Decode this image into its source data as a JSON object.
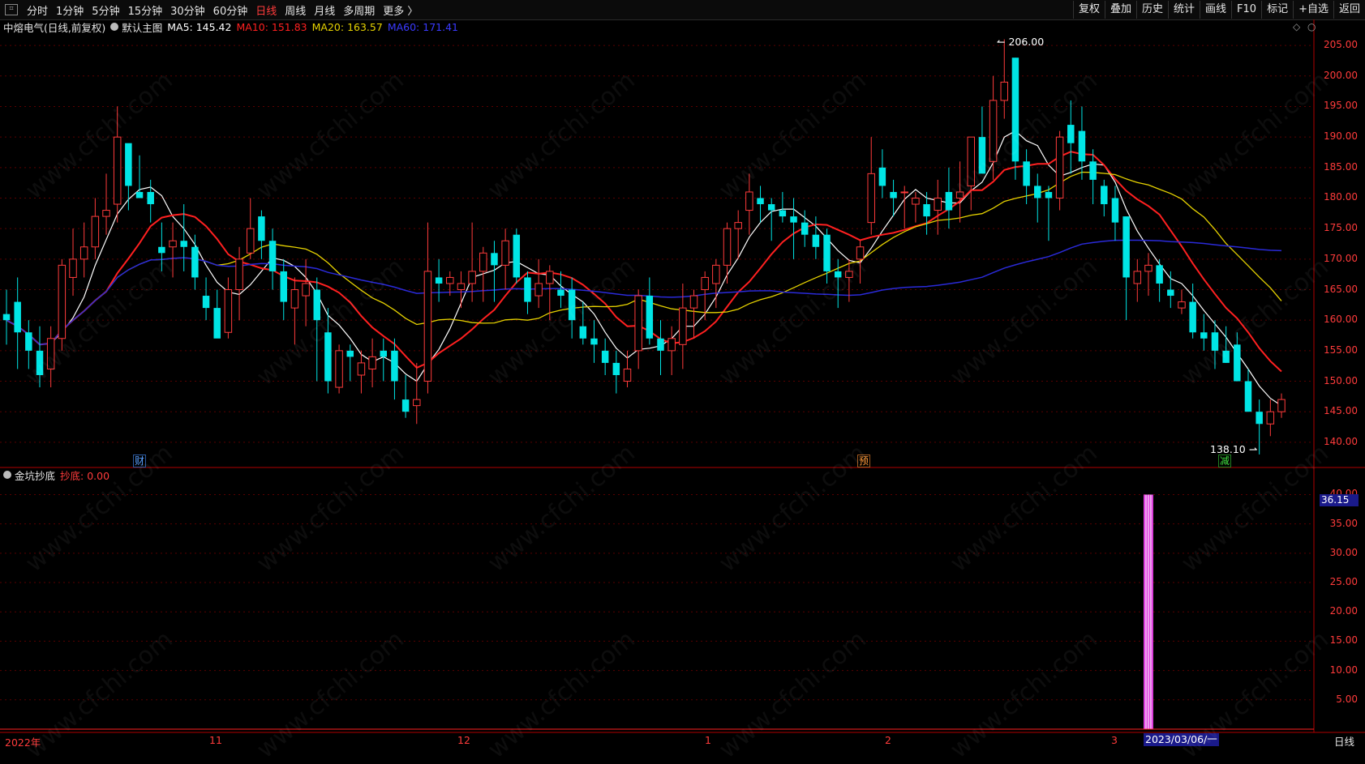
{
  "toolbar": {
    "periods": [
      "分时",
      "1分钟",
      "5分钟",
      "15分钟",
      "30分钟",
      "60分钟",
      "日线",
      "周线",
      "月线",
      "多周期",
      "更多 〉"
    ],
    "active_period": "日线",
    "right_buttons": [
      "复权",
      "叠加",
      "历史",
      "统计",
      "画线",
      "F10",
      "标记",
      "+自选",
      "返回"
    ]
  },
  "main_info": {
    "stock_name": "中熔电气(日线,前复权)",
    "template": "默认主图",
    "ma5": "MA5: 145.42",
    "ma10": "MA10: 151.83",
    "ma20": "MA20: 163.57",
    "ma60": "MA60: 171.41"
  },
  "indicator_info": {
    "name": "金坑抄底",
    "value": "抄底: 0.00"
  },
  "price_axis": [
    "205.00",
    "200.00",
    "195.00",
    "190.00",
    "185.00",
    "180.00",
    "175.00",
    "170.00",
    "165.00",
    "160.00",
    "155.00",
    "150.00",
    "145.00",
    "140.00"
  ],
  "indicator_axis": [
    "40.00",
    "35.00",
    "30.00",
    "25.00",
    "20.00",
    "15.00",
    "10.00",
    "5.00"
  ],
  "indicator_current_value": "36.15",
  "annotations": {
    "high": "206.00",
    "low": "138.10"
  },
  "event_markers": [
    "财",
    "预",
    "减"
  ],
  "date_axis": [
    "2022年",
    "11",
    "12",
    "1",
    "2",
    "3"
  ],
  "cursor_date": "2023/03/06/一",
  "bottom_tab": "日线",
  "watermark": "www.cfchi.com",
  "colors": {
    "up": "#ff3b3b",
    "down": "#00e5e5",
    "ma5": "#ffffff",
    "ma10": "#ff2020",
    "ma20": "#e6d200",
    "ma60": "#2a2ad8",
    "indicator": "#e040e0"
  },
  "chart_data": {
    "type": "candlestick",
    "y_range": [
      136,
      209
    ],
    "indicator_range": [
      0,
      42
    ],
    "candles": [
      [
        161,
        165,
        156,
        160
      ],
      [
        163,
        167,
        152,
        158
      ],
      [
        158,
        160,
        152,
        155
      ],
      [
        155,
        159,
        149,
        151
      ],
      [
        152,
        159,
        149,
        157
      ],
      [
        157,
        170,
        155,
        169
      ],
      [
        167,
        175,
        164,
        170
      ],
      [
        170,
        176,
        167,
        172
      ],
      [
        172,
        180,
        170,
        177
      ],
      [
        177,
        184,
        174,
        178
      ],
      [
        179,
        195,
        176,
        190
      ],
      [
        189,
        186,
        178,
        182
      ],
      [
        181,
        187,
        180,
        180
      ],
      [
        181,
        183,
        176,
        179
      ],
      [
        172,
        176,
        168,
        171
      ],
      [
        172,
        176,
        167,
        173
      ],
      [
        173,
        179,
        168,
        172
      ],
      [
        172,
        174,
        165,
        167
      ],
      [
        164,
        167,
        160,
        162
      ],
      [
        162,
        165,
        159,
        157
      ],
      [
        158,
        167,
        157,
        165
      ],
      [
        165,
        172,
        160,
        170
      ],
      [
        171,
        180,
        170,
        175
      ],
      [
        177,
        178,
        170,
        173
      ],
      [
        173,
        175,
        165,
        168
      ],
      [
        168,
        170,
        160,
        163
      ],
      [
        162,
        167,
        156,
        165
      ],
      [
        164,
        170,
        159,
        166
      ],
      [
        165,
        167,
        150,
        160
      ],
      [
        158,
        162,
        148,
        150
      ],
      [
        149,
        156,
        148,
        155
      ],
      [
        155,
        156,
        150,
        154
      ],
      [
        151,
        155,
        148,
        153
      ],
      [
        152,
        157,
        149,
        154
      ],
      [
        155,
        157,
        150,
        154
      ],
      [
        155,
        157,
        147,
        150
      ],
      [
        147,
        151,
        144,
        145
      ],
      [
        146,
        153,
        143,
        147
      ],
      [
        150,
        176,
        148,
        168
      ],
      [
        167,
        170,
        163,
        166
      ],
      [
        166,
        168,
        164,
        167
      ],
      [
        165,
        168,
        162,
        166
      ],
      [
        166,
        176,
        163,
        168
      ],
      [
        168,
        172,
        163,
        171
      ],
      [
        171,
        173,
        163,
        169
      ],
      [
        169,
        175,
        165,
        173
      ],
      [
        174,
        175,
        166,
        167
      ],
      [
        167,
        168,
        161,
        163
      ],
      [
        164,
        170,
        162,
        166
      ],
      [
        166,
        169,
        160,
        168
      ],
      [
        165,
        168,
        162,
        164
      ],
      [
        165,
        167,
        157,
        160
      ],
      [
        159,
        163,
        156,
        157
      ],
      [
        157,
        160,
        153,
        156
      ],
      [
        155,
        157,
        151,
        153
      ],
      [
        153,
        155,
        148,
        151
      ],
      [
        150,
        155,
        149,
        152
      ],
      [
        155,
        165,
        152,
        164
      ],
      [
        164,
        167,
        156,
        157
      ],
      [
        157,
        160,
        151,
        155
      ],
      [
        155,
        159,
        151,
        157
      ],
      [
        156,
        166,
        152,
        162
      ],
      [
        162,
        165,
        157,
        164
      ],
      [
        165,
        168,
        160,
        167
      ],
      [
        166,
        170,
        162,
        169
      ],
      [
        169,
        176,
        166,
        175
      ],
      [
        175,
        178,
        170,
        176
      ],
      [
        178,
        184,
        174,
        181
      ],
      [
        180,
        182,
        176,
        179
      ],
      [
        179,
        180,
        173,
        178
      ],
      [
        178,
        181,
        176,
        177
      ],
      [
        177,
        180,
        170,
        176
      ],
      [
        176,
        178,
        172,
        174
      ],
      [
        174,
        177,
        170,
        172
      ],
      [
        174,
        175,
        166,
        168
      ],
      [
        168,
        170,
        162,
        167
      ],
      [
        167,
        170,
        163,
        168
      ],
      [
        170,
        173,
        166,
        172
      ],
      [
        176,
        190,
        174,
        184
      ],
      [
        185,
        188,
        180,
        182
      ],
      [
        181,
        183,
        177,
        180
      ],
      [
        181,
        182,
        175,
        181
      ],
      [
        179,
        181,
        176,
        180
      ],
      [
        179,
        181,
        174,
        177
      ],
      [
        178,
        183,
        174,
        180
      ],
      [
        181,
        185,
        175,
        178
      ],
      [
        180,
        186,
        176,
        181
      ],
      [
        182,
        190,
        178,
        190
      ],
      [
        190,
        195,
        186,
        184
      ],
      [
        186,
        200,
        183,
        196
      ],
      [
        196,
        206,
        193,
        199
      ],
      [
        203,
        203,
        183,
        186
      ],
      [
        186,
        188,
        179,
        182
      ],
      [
        182,
        184,
        176,
        180
      ],
      [
        181,
        182,
        173,
        180
      ],
      [
        180,
        191,
        178,
        190
      ],
      [
        192,
        196,
        184,
        189
      ],
      [
        191,
        195,
        183,
        186
      ],
      [
        186,
        188,
        179,
        183
      ],
      [
        182,
        183,
        177,
        179
      ],
      [
        180,
        182,
        173,
        176
      ],
      [
        177,
        177,
        160,
        167
      ],
      [
        166,
        170,
        163,
        168
      ],
      [
        168,
        171,
        164,
        169
      ],
      [
        169,
        170,
        163,
        166
      ],
      [
        165,
        168,
        162,
        164
      ],
      [
        162,
        165,
        161,
        163
      ],
      [
        163,
        166,
        157,
        158
      ],
      [
        158,
        161,
        155,
        157
      ],
      [
        158,
        160,
        152,
        155
      ],
      [
        155,
        159,
        153,
        153
      ],
      [
        156,
        158,
        151,
        150
      ],
      [
        150,
        152,
        145,
        145
      ],
      [
        145,
        147,
        138,
        143
      ],
      [
        143,
        147,
        141,
        145
      ],
      [
        145,
        148,
        144,
        147
      ]
    ],
    "indicator_bar": {
      "index": 103,
      "value": 40
    }
  }
}
